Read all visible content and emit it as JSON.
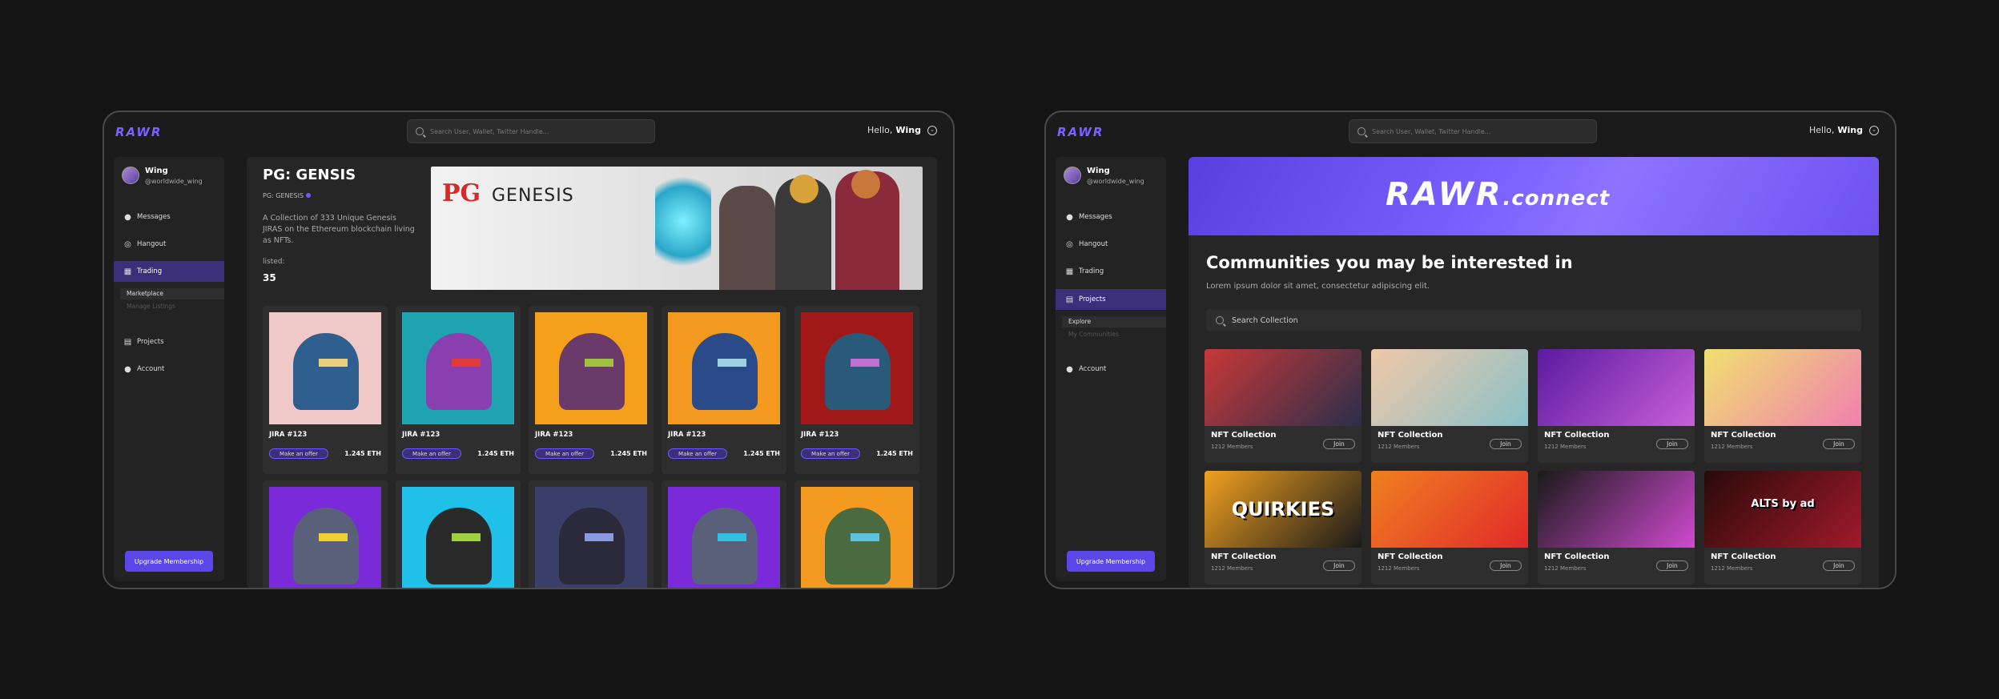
{
  "common": {
    "logo": "RAWR",
    "search_placeholder": "Search User, Wallet, Twitter Handle...",
    "hello_prefix": "Hello,",
    "hello_name": "Wing",
    "profile_name": "Wing",
    "profile_handle": "@worldwide_wing",
    "upgrade": "Upgrade Membership"
  },
  "left": {
    "nav": {
      "messages": "Messages",
      "hangout": "Hangout",
      "trading": "Trading",
      "marketplace": "Marketplace",
      "manage_listings": "Manage Listings",
      "projects": "Projects",
      "account": "Account"
    },
    "project": {
      "title": "PG: GENSIS",
      "subtitle": "PG: GENESIS",
      "description": "A Collection of 333 Unique Genesis JIRAS on the Ethereum blockchain living as NFTs.",
      "listed_label": "listed:",
      "listed_count": "35",
      "banner_pg": "PG",
      "banner_genesis": "GENESIS"
    },
    "cards": [
      {
        "name": "JIRA #123",
        "offer": "Make an offer",
        "price": "1.245 ETH",
        "bg": "#f0c8c8",
        "head": "#2f5f8f",
        "eye": "#e8d080"
      },
      {
        "name": "JIRA #123",
        "offer": "Make an offer",
        "price": "1.245 ETH",
        "bg": "#1fa3b0",
        "head": "#8a3fb0",
        "eye": "#e03a3a"
      },
      {
        "name": "JIRA #123",
        "offer": "Make an offer",
        "price": "1.245 ETH",
        "bg": "#f5a01a",
        "head": "#6a3a6a",
        "eye": "#9fc040"
      },
      {
        "name": "JIRA #123",
        "offer": "Make an offer",
        "price": "1.245 ETH",
        "bg": "#f59a20",
        "head": "#2a4a8a",
        "eye": "#9fd0e0"
      },
      {
        "name": "JIRA #123",
        "offer": "Make an offer",
        "price": "1.245 ETH",
        "bg": "#a01818",
        "head": "#2a5a7a",
        "eye": "#c070d0"
      },
      {
        "name": "",
        "offer": "",
        "price": "",
        "bg": "#7a2ad8",
        "head": "#5a5f7a",
        "eye": "#f0d030"
      },
      {
        "name": "",
        "offer": "",
        "price": "",
        "bg": "#20c0e8",
        "head": "#2a2a2a",
        "eye": "#a0d040"
      },
      {
        "name": "",
        "offer": "",
        "price": "",
        "bg": "#3a3f6a",
        "head": "#2a2a3a",
        "eye": "#8a9adf"
      },
      {
        "name": "",
        "offer": "",
        "price": "",
        "bg": "#7a2ad8",
        "head": "#5a5f7a",
        "eye": "#30c0e0"
      },
      {
        "name": "",
        "offer": "",
        "price": "",
        "bg": "#f59a20",
        "head": "#4a6a40",
        "eye": "#60c0e0"
      }
    ]
  },
  "right": {
    "nav": {
      "messages": "Messages",
      "hangout": "Hangout",
      "trading": "Trading",
      "projects": "Projects",
      "explore": "Explore",
      "my_communities": "My Communities",
      "account": "Account"
    },
    "banner_logo": "RAWR",
    "banner_suffix": ".connect",
    "title": "Communities you may be interested in",
    "subtitle": "Lorem ipsum dolor sit amet, consectetur adipiscing elit.",
    "search_placeholder": "Search Collection",
    "collections": [
      {
        "title": "NFT Collection",
        "members": "1212 Members",
        "join": "Join",
        "c1": "#c83838",
        "c2": "#2a2f4a"
      },
      {
        "title": "NFT Collection",
        "members": "1212 Members",
        "join": "Join",
        "c1": "#f0c8a8",
        "c2": "#8ac0c8"
      },
      {
        "title": "NFT Collection",
        "members": "1212 Members",
        "join": "Join",
        "c1": "#5a1aa0",
        "c2": "#c860d8"
      },
      {
        "title": "NFT Collection",
        "members": "1212 Members",
        "join": "Join",
        "c1": "#f0e070",
        "c2": "#f080b0"
      },
      {
        "title": "NFT Collection",
        "members": "1212 Members",
        "join": "Join",
        "c1": "#f0a020",
        "c2": "#1a1a1a",
        "text": "QUIRKIES"
      },
      {
        "title": "NFT Collection",
        "members": "1212 Members",
        "join": "Join",
        "c1": "#f08020",
        "c2": "#e02a2a"
      },
      {
        "title": "NFT Collection",
        "members": "1212 Members",
        "join": "Join",
        "c1": "#1a1a1a",
        "c2": "#d04ad0"
      },
      {
        "title": "NFT Collection",
        "members": "1212 Members",
        "join": "Join",
        "c1": "#2a0a0a",
        "c2": "#a01a2a",
        "text": "ALTS by ad"
      }
    ]
  },
  "colors": {
    "accent": "#5b47e8",
    "active_nav": "#3b2f7a",
    "bg": "#141414"
  }
}
